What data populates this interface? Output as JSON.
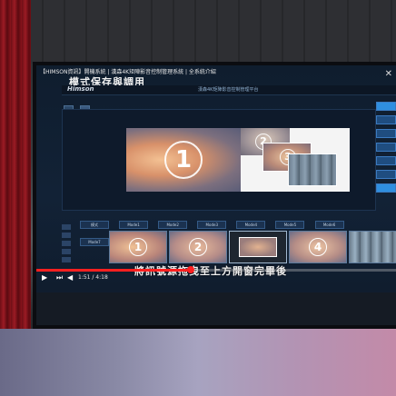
{
  "video": {
    "title": "【HIMSON資訊】開機系統 | 漢森4K矩陣影音控制管理系統 | 全系統介紹",
    "close_glyph": "✕",
    "time": "1:51 / 4:18",
    "progress_fraction": 0.43,
    "subtitle": "將訊號源拖曳至上方開窗完畢後"
  },
  "app": {
    "mode_label": "模式保存與調用",
    "logo": "Himson",
    "window_title": "漢森4K矩陣影音控制管理平台",
    "mode_buttons": [
      "模式",
      "Mode1",
      "Mode2",
      "Mode3",
      "Mode4",
      "Mode5",
      "Mode6",
      "Mode7"
    ],
    "right_buttons": [
      "",
      "",
      "",
      "",
      "",
      "",
      ""
    ],
    "preview_numbers": [
      "1",
      "2",
      "3"
    ],
    "thumbnail_numbers": [
      "1",
      "2",
      "",
      "4",
      ""
    ]
  },
  "colors": {
    "progress": "#ff2020",
    "curtain": "#8a141c",
    "accent": "#2f8fe0"
  }
}
